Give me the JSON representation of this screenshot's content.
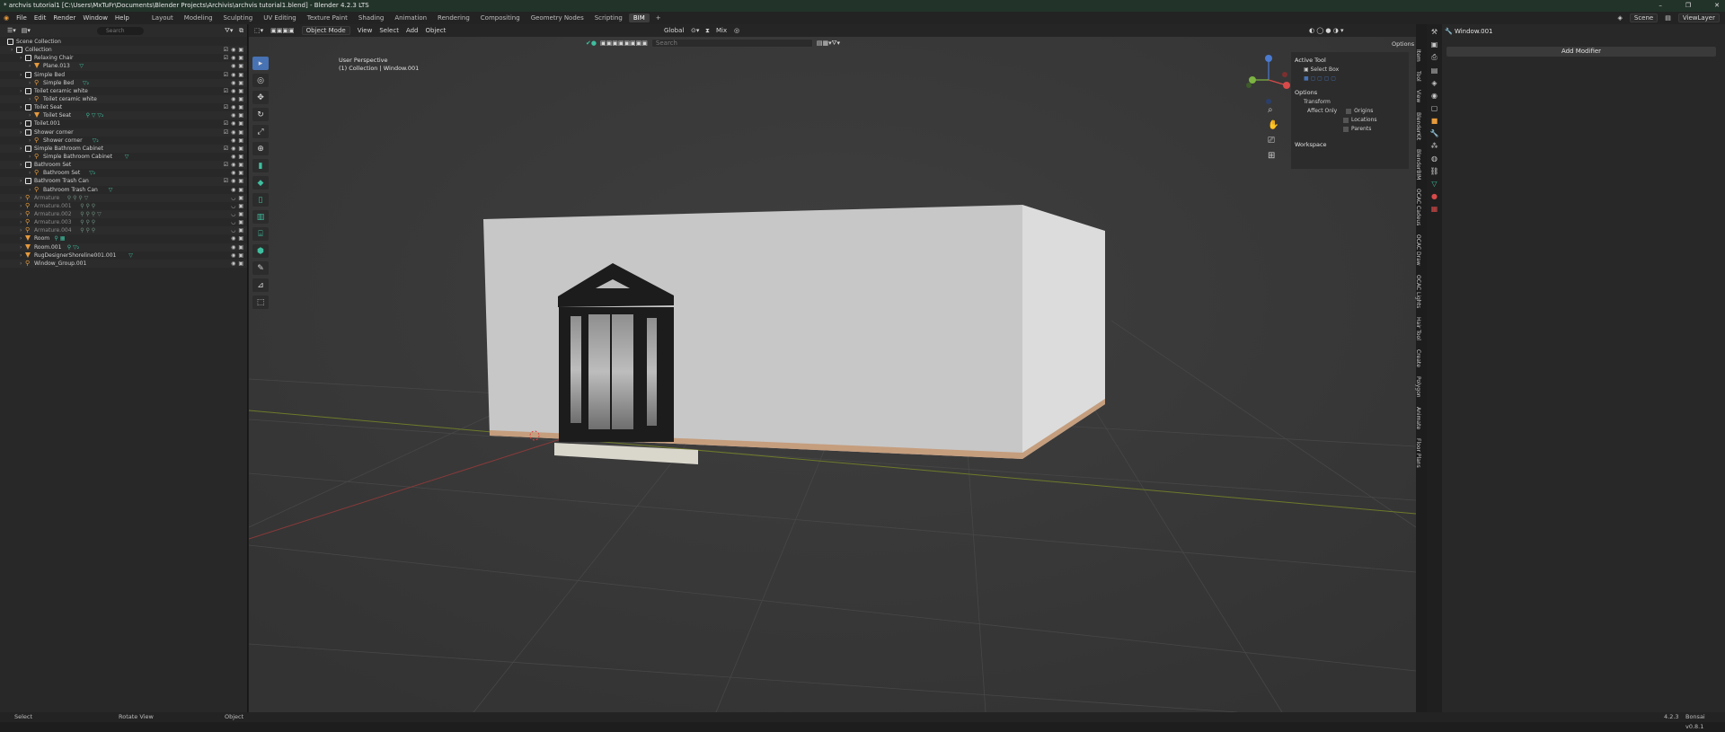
{
  "window": {
    "title": "* archvis tutorial1 [C:\\Users\\MxTuFr\\Documents\\Blender Projects\\Archivis\\archvis tutorial1.blend] - Blender 4.2.3 LTS",
    "minimize": "–",
    "maximize": "❐",
    "close": "✕"
  },
  "menubar": {
    "items": [
      "File",
      "Edit",
      "Render",
      "Window",
      "Help"
    ],
    "workspaces": [
      "Layout",
      "Modeling",
      "Sculpting",
      "UV Editing",
      "Texture Paint",
      "Shading",
      "Animation",
      "Rendering",
      "Compositing",
      "Geometry Nodes",
      "Scripting",
      "BIM",
      "+"
    ],
    "active_workspace": "BIM",
    "scene": "Scene",
    "view_layer": "ViewLayer"
  },
  "outliner": {
    "search_placeholder": "Search",
    "rows": [
      {
        "indent": 0,
        "label": "Scene Collection",
        "icon": "collection",
        "dim": false,
        "tags": ""
      },
      {
        "indent": 1,
        "label": "Collection",
        "icon": "collection",
        "dim": false,
        "tags": ""
      },
      {
        "indent": 2,
        "label": "Relaxing Chair",
        "icon": "collection",
        "dim": false,
        "tags": ""
      },
      {
        "indent": 3,
        "label": "Plane.013",
        "icon": "mesh",
        "dim": false,
        "tags": "▽"
      },
      {
        "indent": 2,
        "label": "Simple Bed",
        "icon": "collection",
        "dim": false,
        "tags": ""
      },
      {
        "indent": 3,
        "label": "Simple Bed",
        "icon": "armature",
        "dim": false,
        "tags": "▽₂"
      },
      {
        "indent": 2,
        "label": "Toilet ceramic white",
        "icon": "collection",
        "dim": false,
        "tags": ""
      },
      {
        "indent": 3,
        "label": "Toilet ceramic white",
        "icon": "armature",
        "dim": false,
        "tags": ""
      },
      {
        "indent": 2,
        "label": "Toilet Seat",
        "icon": "collection",
        "dim": false,
        "tags": ""
      },
      {
        "indent": 3,
        "label": "Toilet Seat",
        "icon": "mesh",
        "dim": false,
        "tags": "⚲ ▽ ▽₂"
      },
      {
        "indent": 2,
        "label": "Toilet.001",
        "icon": "collection",
        "dim": false,
        "tags": ""
      },
      {
        "indent": 2,
        "label": "Shower corner",
        "icon": "collection",
        "dim": false,
        "tags": ""
      },
      {
        "indent": 3,
        "label": "Shower corner",
        "icon": "armature",
        "dim": false,
        "tags": "▽₂"
      },
      {
        "indent": 2,
        "label": "Simple Bathroom Cabinet",
        "icon": "collection",
        "dim": false,
        "tags": ""
      },
      {
        "indent": 3,
        "label": "Simple Bathroom Cabinet",
        "icon": "armature",
        "dim": false,
        "tags": "▽"
      },
      {
        "indent": 2,
        "label": "Bathroom Set",
        "icon": "collection",
        "dim": false,
        "tags": ""
      },
      {
        "indent": 3,
        "label": "Bathroom Set",
        "icon": "armature",
        "dim": false,
        "tags": "▽₂"
      },
      {
        "indent": 2,
        "label": "Bathroom Trash Can",
        "icon": "collection",
        "dim": false,
        "tags": ""
      },
      {
        "indent": 3,
        "label": "Bathroom Trash Can",
        "icon": "armature",
        "dim": false,
        "tags": "▽"
      },
      {
        "indent": 2,
        "label": "Armature",
        "icon": "armature",
        "dim": true,
        "tags": "⚲ ⚲ ⚲ ▽"
      },
      {
        "indent": 2,
        "label": "Armature.001",
        "icon": "armature",
        "dim": true,
        "tags": "⚲ ⚲ ⚲"
      },
      {
        "indent": 2,
        "label": "Armature.002",
        "icon": "armature",
        "dim": true,
        "tags": "⚲ ⚲ ⚲ ▽"
      },
      {
        "indent": 2,
        "label": "Armature.003",
        "icon": "armature",
        "dim": true,
        "tags": "⚲ ⚲ ⚲"
      },
      {
        "indent": 2,
        "label": "Armature.004",
        "icon": "armature",
        "dim": true,
        "tags": "⚲ ⚲ ⚲"
      },
      {
        "indent": 2,
        "label": "Room",
        "icon": "mesh",
        "dim": false,
        "tags": "⚲ ▦"
      },
      {
        "indent": 2,
        "label": "Room.001",
        "icon": "mesh",
        "dim": false,
        "tags": "⚲ ▽₂"
      },
      {
        "indent": 2,
        "label": "RugDesignerShoreline001.001",
        "icon": "mesh",
        "dim": false,
        "tags": "▽"
      },
      {
        "indent": 2,
        "label": "Window_Group.001",
        "icon": "armature",
        "dim": false,
        "tags": ""
      }
    ]
  },
  "viewport": {
    "mode": "Object Mode",
    "menus": [
      "View",
      "Select",
      "Add",
      "Object"
    ],
    "transform_orientation": "Global",
    "shading": "Mix",
    "search_placeholder": "Search",
    "options": "Options",
    "info_line1": "User Perspective",
    "info_line2": "(1) Collection | Window.001"
  },
  "npanel": {
    "active_tool_title": "Active Tool",
    "select_box": "Select Box",
    "options_title": "Options",
    "transform_title": "Transform",
    "affect_only": "Affect Only",
    "origins": "Origins",
    "locations": "Locations",
    "parents": "Parents",
    "workspace": "Workspace",
    "tabs": [
      "Item",
      "Tool",
      "View",
      "BlenderKit",
      "BlenderBIM",
      "OCAC Cadeus",
      "OCAC Draw",
      "OCAC Lights",
      "Hair Tool",
      "Create",
      "Polygon",
      "Animate",
      "Floor Plans"
    ]
  },
  "properties": {
    "object_name": "Window.001",
    "add_modifier": "Add Modifier"
  },
  "statusbar": {
    "select": "Select",
    "rotate": "Rotate View",
    "object": "Object",
    "version": "4.2.3",
    "addon_version": "Bonsai v0.8.1"
  },
  "colors": {
    "accent": "#4772b3",
    "wall": "#c9c9c9",
    "frame": "#1c1c1c",
    "mesh_icon": "#e69a3c",
    "material_icon": "#3fbf9f"
  }
}
